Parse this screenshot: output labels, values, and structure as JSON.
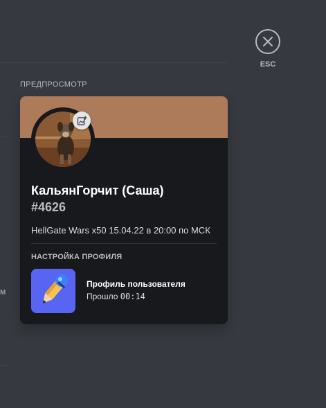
{
  "close": {
    "label": "ESC",
    "icon": "close-icon"
  },
  "edge_text": "м",
  "preview": {
    "section_label": "ПРЕДПРОСМОТР",
    "banner_color": "#ad7a5a",
    "profile": {
      "username": "КальянГорчит (Саша)",
      "discriminator": "#4626",
      "custom_status": "HellGate Wars x50 15.04.22 в 20:00 по МСК",
      "avatar_icon": "avatar-dog-photo",
      "avatar_edit_icon": "image-add-icon"
    },
    "activity": {
      "section_title": "НАСТРОЙКА ПРОФИЛЯ",
      "icon": "pencil-brush-icon",
      "name": "Профиль пользователя",
      "elapsed_prefix": "Прошло",
      "elapsed_time": "00:14"
    }
  }
}
